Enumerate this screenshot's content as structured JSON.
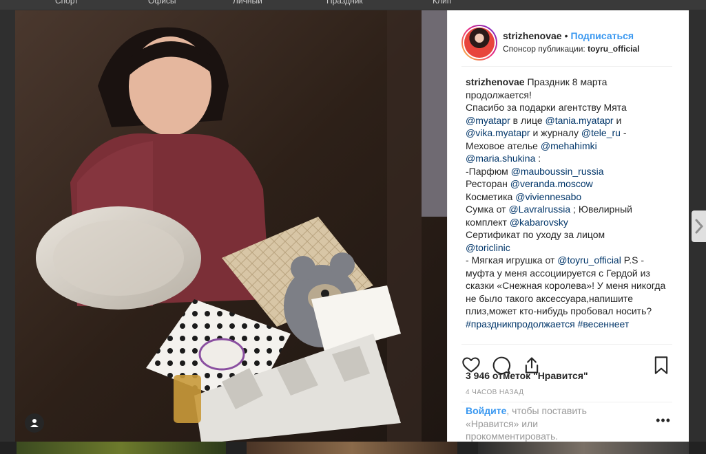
{
  "background_nav": [
    "Спорт",
    "Офисы",
    "Личный",
    "Праздник",
    "Клип"
  ],
  "post": {
    "username": "strizhenovae",
    "separator": "•",
    "follow_label": "Подписаться",
    "sponsor_prefix": "Спонсор публикации:",
    "sponsor_name": "toyru_official",
    "caption_user": "strizhenovae",
    "caption_parts": [
      {
        "text": " Праздник 8 марта продолжается!\nСпасибо за подарки агентству Мята\n"
      },
      {
        "text": "@myatapr",
        "tag": true
      },
      {
        "text": " в лице "
      },
      {
        "text": "@tania.myatapr",
        "tag": true
      },
      {
        "text": " и\n"
      },
      {
        "text": "@vika.myatapr",
        "tag": true
      },
      {
        "text": " и журналу "
      },
      {
        "text": "@tele_ru",
        "tag": true
      },
      {
        "text": " -\nМеховое ателье "
      },
      {
        "text": "@mehahimki",
        "tag": true
      },
      {
        "text": "\n"
      },
      {
        "text": "@maria.shukina",
        "tag": true
      },
      {
        "text": " :\n-Парфюм "
      },
      {
        "text": "@mauboussin_russia",
        "tag": true
      },
      {
        "text": "\nРесторан "
      },
      {
        "text": "@veranda.moscow",
        "tag": true
      },
      {
        "text": "\nКосметика "
      },
      {
        "text": "@viviennesabo",
        "tag": true
      },
      {
        "text": "\nСумка от "
      },
      {
        "text": "@Lavralrussia",
        "tag": true
      },
      {
        "text": " ; Ювелирный комплект "
      },
      {
        "text": "@kabarovsky",
        "tag": true
      },
      {
        "text": "\nСертификат по уходу за лицом\n"
      },
      {
        "text": "@toriclinic",
        "tag": true
      },
      {
        "text": "\n- Мягкая игрушка от "
      },
      {
        "text": "@toyru_official",
        "tag": true
      },
      {
        "text": " P.S - муфта у меня ассоциируется с Гердой из сказки «Снежная королева»! У меня никогда не было такого аксессуара,напишите плиз,может кто-нибудь пробовал носить?\n"
      },
      {
        "text": "#праздникпродолжается",
        "tag": true
      },
      {
        "text": " "
      },
      {
        "text": "#весеннеет",
        "tag": true
      }
    ],
    "likes_text": "3 946 отметок \"Нравится\"",
    "time_text": "4 ЧАСОВ НАЗАД",
    "login_link": "Войдите",
    "login_rest": ", чтобы поставить «Нравится» или прокомментировать.",
    "more_label": "•••"
  },
  "icons": {
    "like": "heart-icon",
    "comment": "comment-icon",
    "share": "share-icon",
    "save": "bookmark-icon",
    "user_tag": "user-icon",
    "next": "chevron-right-icon"
  },
  "colors": {
    "link": "#3897f0",
    "mention": "#003569",
    "text": "#262626",
    "muted": "#999999"
  }
}
